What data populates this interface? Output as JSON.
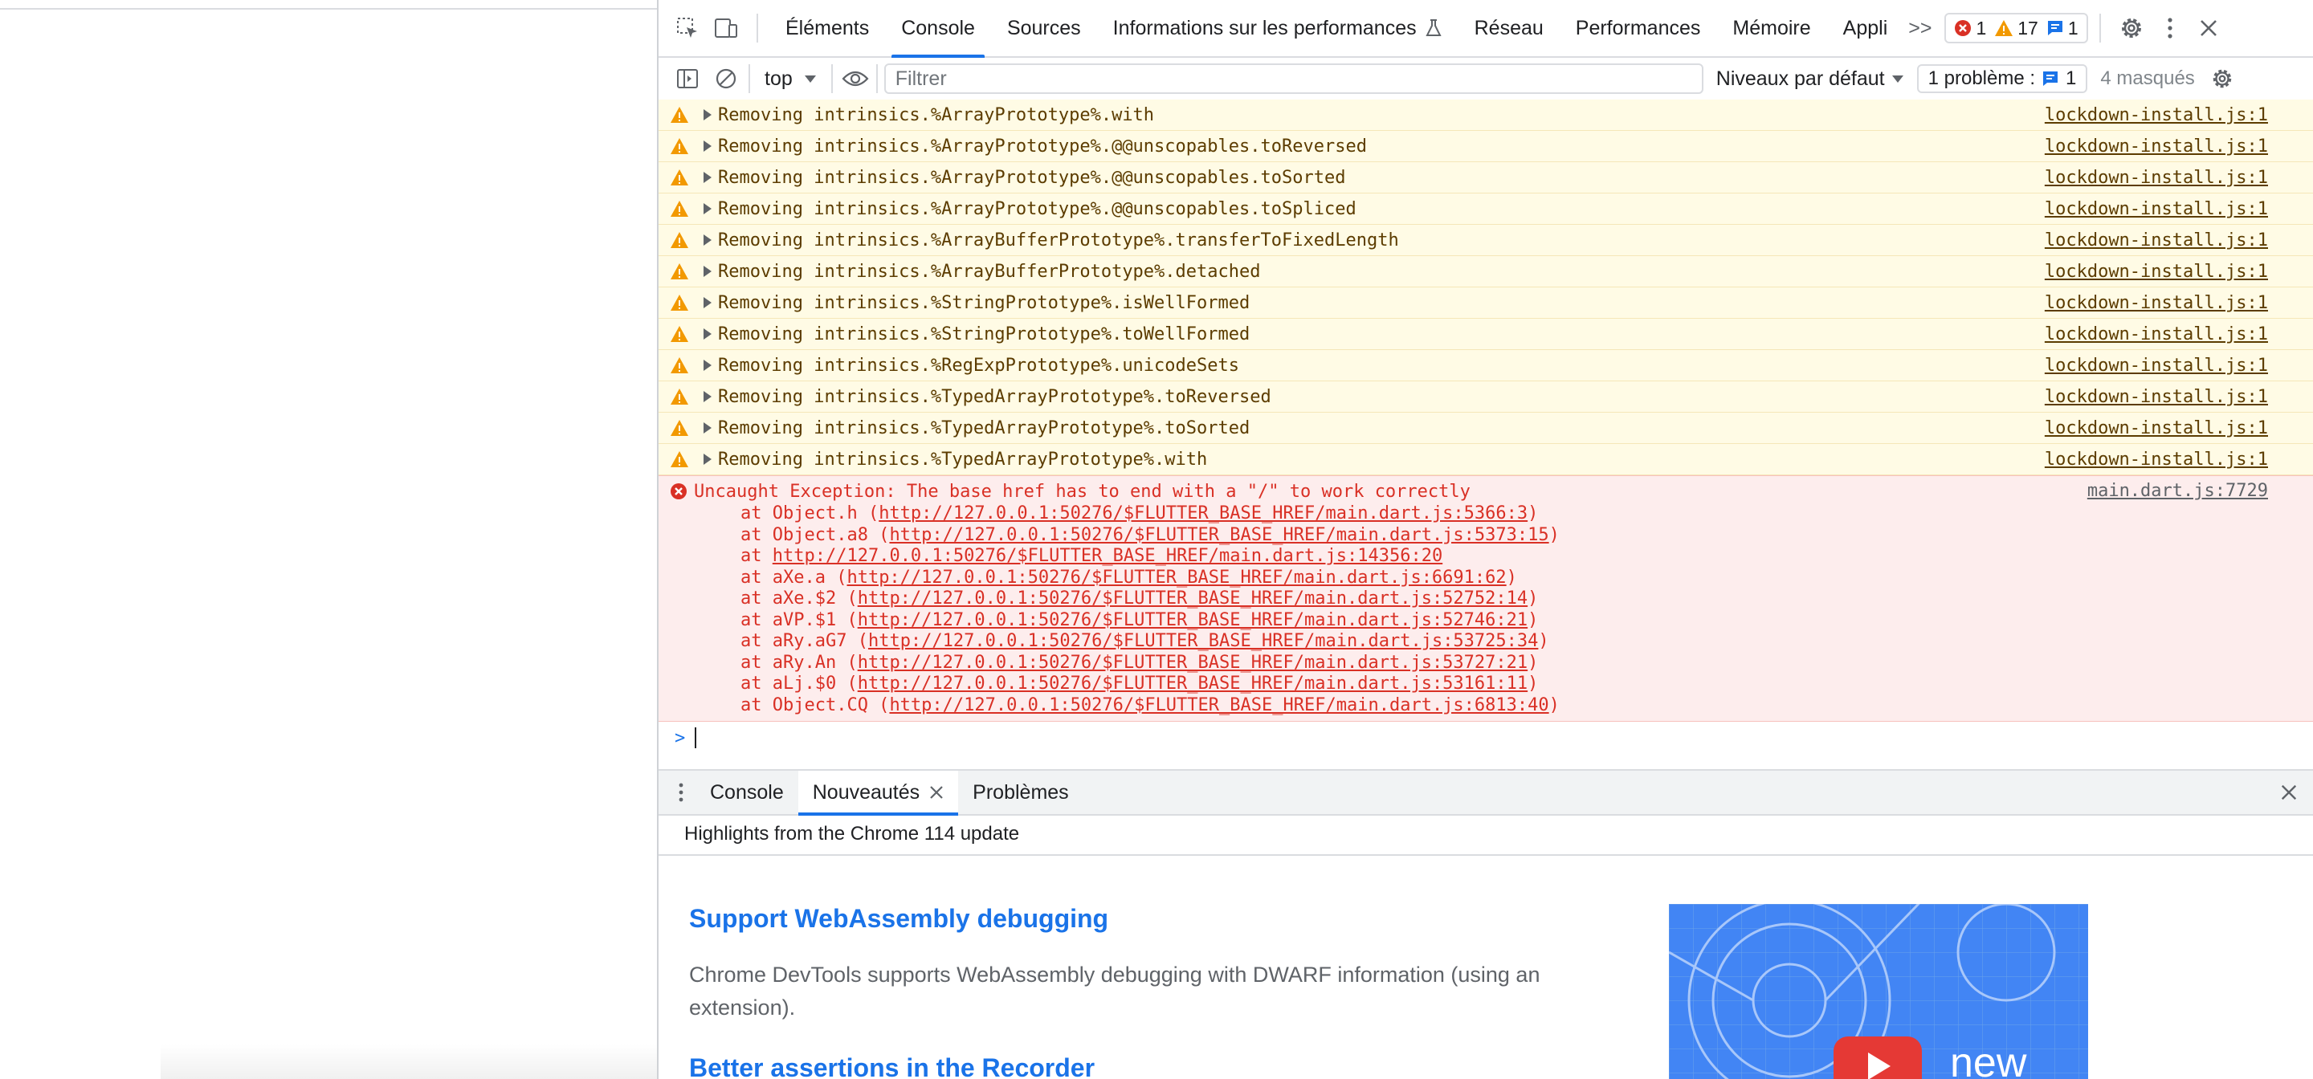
{
  "tabs": {
    "items": [
      "Éléments",
      "Console",
      "Sources",
      "Informations sur les performances",
      "Réseau",
      "Performances",
      "Mémoire",
      "Appli"
    ],
    "active": "Console",
    "more": ">>"
  },
  "counts": {
    "errors": "1",
    "warnings": "17",
    "messages": "1"
  },
  "toolbar": {
    "context": "top",
    "filter_placeholder": "Filtrer",
    "levels": "Niveaux par défaut",
    "issues_label": "1 problème :",
    "issues_count": "1",
    "hidden": "4 masqués"
  },
  "warnings": [
    {
      "text": "Removing intrinsics.%ArrayPrototype%.with",
      "source": "lockdown-install.js:1"
    },
    {
      "text": "Removing intrinsics.%ArrayPrototype%.@@unscopables.toReversed",
      "source": "lockdown-install.js:1"
    },
    {
      "text": "Removing intrinsics.%ArrayPrototype%.@@unscopables.toSorted",
      "source": "lockdown-install.js:1"
    },
    {
      "text": "Removing intrinsics.%ArrayPrototype%.@@unscopables.toSpliced",
      "source": "lockdown-install.js:1"
    },
    {
      "text": "Removing intrinsics.%ArrayBufferPrototype%.transferToFixedLength",
      "source": "lockdown-install.js:1"
    },
    {
      "text": "Removing intrinsics.%ArrayBufferPrototype%.detached",
      "source": "lockdown-install.js:1"
    },
    {
      "text": "Removing intrinsics.%StringPrototype%.isWellFormed",
      "source": "lockdown-install.js:1"
    },
    {
      "text": "Removing intrinsics.%StringPrototype%.toWellFormed",
      "source": "lockdown-install.js:1"
    },
    {
      "text": "Removing intrinsics.%RegExpPrototype%.unicodeSets",
      "source": "lockdown-install.js:1"
    },
    {
      "text": "Removing intrinsics.%TypedArrayPrototype%.toReversed",
      "source": "lockdown-install.js:1"
    },
    {
      "text": "Removing intrinsics.%TypedArrayPrototype%.toSorted",
      "source": "lockdown-install.js:1"
    },
    {
      "text": "Removing intrinsics.%TypedArrayPrototype%.with",
      "source": "lockdown-install.js:1"
    }
  ],
  "error": {
    "text": "Uncaught Exception: The base href has to end with a \"/\" to work correctly",
    "source": "main.dart.js:7729",
    "stack": [
      {
        "prefix": "at Object.h (",
        "url": "http://127.0.0.1:50276/$FLUTTER_BASE_HREF/main.dart.js:5366:3",
        "suffix": ")"
      },
      {
        "prefix": "at Object.a8 (",
        "url": "http://127.0.0.1:50276/$FLUTTER_BASE_HREF/main.dart.js:5373:15",
        "suffix": ")"
      },
      {
        "prefix": "at ",
        "url": "http://127.0.0.1:50276/$FLUTTER_BASE_HREF/main.dart.js:14356:20",
        "suffix": ""
      },
      {
        "prefix": "at aXe.a (",
        "url": "http://127.0.0.1:50276/$FLUTTER_BASE_HREF/main.dart.js:6691:62",
        "suffix": ")"
      },
      {
        "prefix": "at aXe.$2 (",
        "url": "http://127.0.0.1:50276/$FLUTTER_BASE_HREF/main.dart.js:52752:14",
        "suffix": ")"
      },
      {
        "prefix": "at aVP.$1 (",
        "url": "http://127.0.0.1:50276/$FLUTTER_BASE_HREF/main.dart.js:52746:21",
        "suffix": ")"
      },
      {
        "prefix": "at aRy.aG7 (",
        "url": "http://127.0.0.1:50276/$FLUTTER_BASE_HREF/main.dart.js:53725:34",
        "suffix": ")"
      },
      {
        "prefix": "at aRy.An (",
        "url": "http://127.0.0.1:50276/$FLUTTER_BASE_HREF/main.dart.js:53727:21",
        "suffix": ")"
      },
      {
        "prefix": "at aLj.$0 (",
        "url": "http://127.0.0.1:50276/$FLUTTER_BASE_HREF/main.dart.js:53161:11",
        "suffix": ")"
      },
      {
        "prefix": "at Object.CQ (",
        "url": "http://127.0.0.1:50276/$FLUTTER_BASE_HREF/main.dart.js:6813:40",
        "suffix": ")"
      }
    ]
  },
  "prompt": ">",
  "drawer": {
    "tabs": [
      "Console",
      "Nouveautés",
      "Problèmes"
    ],
    "active": "Nouveautés",
    "header": "Highlights from the Chrome 114 update",
    "whatsnew": {
      "title1": "Support WebAssembly debugging",
      "text1": "Chrome DevTools supports WebAssembly debugging with DWARF information (using an extension).",
      "title2": "Better assertions in the Recorder",
      "thumb_text": "new"
    }
  },
  "colors": {
    "accent": "#1a73e8",
    "warning_bg": "#fffbe5",
    "warning_icon": "#f29900",
    "error_bg": "#fdeded",
    "error_text": "#d93025"
  }
}
